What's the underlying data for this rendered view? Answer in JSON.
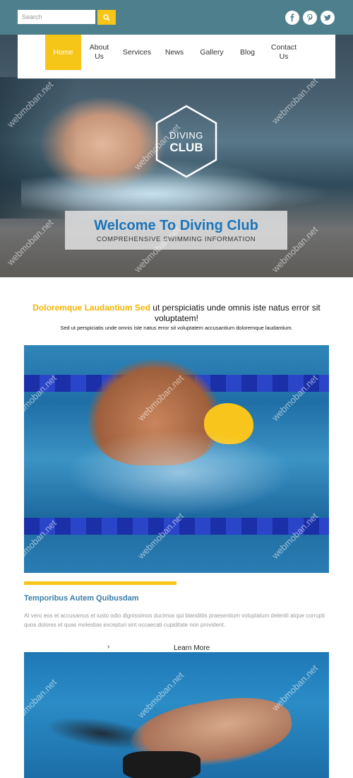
{
  "search": {
    "placeholder": "Search"
  },
  "social": [
    "facebook-icon",
    "pinterest-icon",
    "twitter-icon"
  ],
  "nav": {
    "items": [
      {
        "label": "Home",
        "active": true
      },
      {
        "label": "About Us",
        "active": false
      },
      {
        "label": "Services",
        "active": false
      },
      {
        "label": "News",
        "active": false
      },
      {
        "label": "Gallery",
        "active": false
      },
      {
        "label": "Blog",
        "active": false
      },
      {
        "label": "Contact Us",
        "active": false
      }
    ]
  },
  "logo": {
    "line1": "DIVING",
    "line2": "CLUB"
  },
  "hero": {
    "title": "Welcome To Diving Club",
    "subtitle": "COMPREHENSIVE SWIMMING INFORMATION"
  },
  "intro": {
    "highlight": "Doloremque Laudantium Sed",
    "rest": "ut perspiciatis unde omnis iste natus error sit voluptatem!",
    "sub": "Sed ut perspiciatis unde omnis iste natus error sit voluptatem accusantium doloremque laudantium."
  },
  "section": {
    "title": "Temporibus Autem Quibusdam",
    "text": "At vero eos et accusamus et iusto odio dignissimos ducimus qui blanditiis praesentium voluptatum deleniti atque corrupti quos dolores et quas molestias excepturi sint occaecati cupiditate non provident.",
    "chevron": "›",
    "learn_more": "Learn More"
  },
  "watermark": "webmoban.net",
  "colors": {
    "topbar": "#4e7f8c",
    "accent": "#f5c518",
    "title_blue": "#1b75bb",
    "section_blue": "#3a7da8"
  }
}
